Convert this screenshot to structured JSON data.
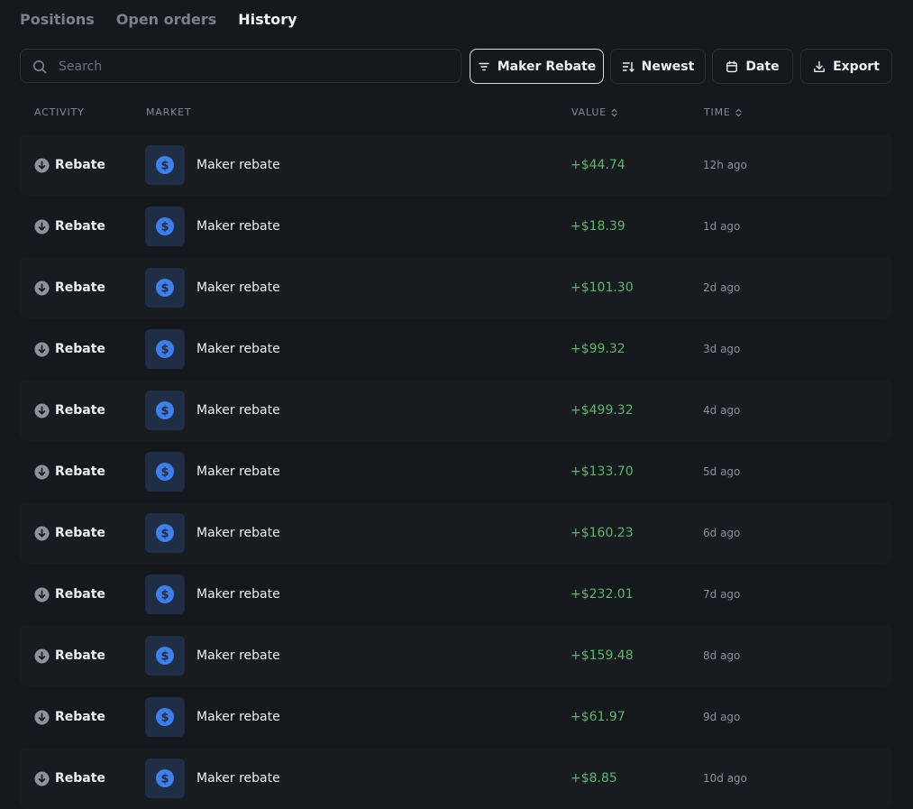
{
  "tabs": [
    {
      "label": "Positions",
      "active": false
    },
    {
      "label": "Open orders",
      "active": false
    },
    {
      "label": "History",
      "active": true
    }
  ],
  "toolbar": {
    "search_placeholder": "Search",
    "filter_label": "Maker Rebate",
    "sort_label": "Newest",
    "date_label": "Date",
    "export_label": "Export"
  },
  "table": {
    "columns": {
      "activity": "ACTIVITY",
      "market": "MARKET",
      "value": "VALUE",
      "time": "TIME"
    },
    "rows": [
      {
        "activity": "Rebate",
        "market": "Maker rebate",
        "value": "+$44.74",
        "time": "12h ago"
      },
      {
        "activity": "Rebate",
        "market": "Maker rebate",
        "value": "+$18.39",
        "time": "1d ago"
      },
      {
        "activity": "Rebate",
        "market": "Maker rebate",
        "value": "+$101.30",
        "time": "2d ago"
      },
      {
        "activity": "Rebate",
        "market": "Maker rebate",
        "value": "+$99.32",
        "time": "3d ago"
      },
      {
        "activity": "Rebate",
        "market": "Maker rebate",
        "value": "+$499.32",
        "time": "4d ago"
      },
      {
        "activity": "Rebate",
        "market": "Maker rebate",
        "value": "+$133.70",
        "time": "5d ago"
      },
      {
        "activity": "Rebate",
        "market": "Maker rebate",
        "value": "+$160.23",
        "time": "6d ago"
      },
      {
        "activity": "Rebate",
        "market": "Maker rebate",
        "value": "+$232.01",
        "time": "7d ago"
      },
      {
        "activity": "Rebate",
        "market": "Maker rebate",
        "value": "+$159.48",
        "time": "8d ago"
      },
      {
        "activity": "Rebate",
        "market": "Maker rebate",
        "value": "+$61.97",
        "time": "9d ago"
      },
      {
        "activity": "Rebate",
        "market": "Maker rebate",
        "value": "+$8.85",
        "time": "10d ago"
      }
    ]
  },
  "icons": {
    "search": "search-icon",
    "filter": "filter-icon",
    "sort": "sort-icon",
    "date": "calendar-icon",
    "export": "download-icon",
    "activity": "arrow-down-circle-icon",
    "market": "dollar-coin-icon",
    "sortable_column": "sort-arrows-icon"
  },
  "colors": {
    "background": "#15181c",
    "row_alt": "#181c20",
    "positive_value": "#5fb56a",
    "market_badge": "#1f2d45",
    "coin": "#3f7fe8"
  }
}
